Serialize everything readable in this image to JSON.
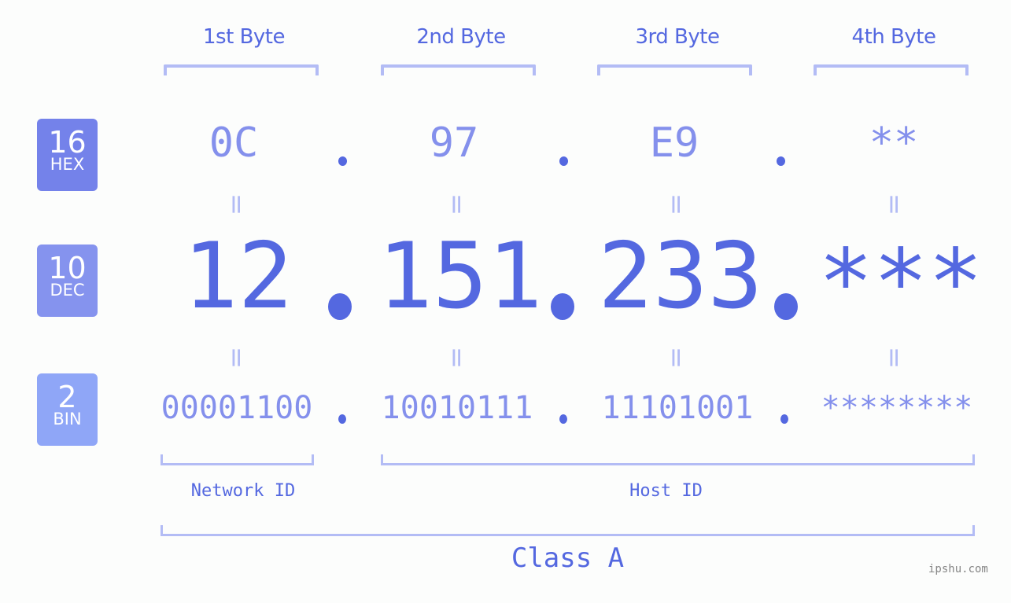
{
  "byte_headers": [
    "1st Byte",
    "2nd Byte",
    "3rd Byte",
    "4th Byte"
  ],
  "bases": [
    {
      "num": "16",
      "label": "HEX",
      "color": "#7482ea"
    },
    {
      "num": "10",
      "label": "DEC",
      "color": "#8593ee"
    },
    {
      "num": "2",
      "label": "BIN",
      "color": "#8fa6f7"
    }
  ],
  "hex": [
    "0C",
    "97",
    "E9",
    "**"
  ],
  "dec": [
    "12",
    "151",
    "233",
    "***"
  ],
  "bin": [
    "00001100",
    "10010111",
    "11101001",
    "********"
  ],
  "equals_sign": "=",
  "network_label": "Network ID",
  "host_label": "Host ID",
  "class_label": "Class A",
  "watermark": "ipshu.com",
  "colors": {
    "accent": "#5468e0",
    "light_accent": "#8490ec",
    "bracket": "#b3bcf5",
    "background": "#fcfdfc"
  }
}
